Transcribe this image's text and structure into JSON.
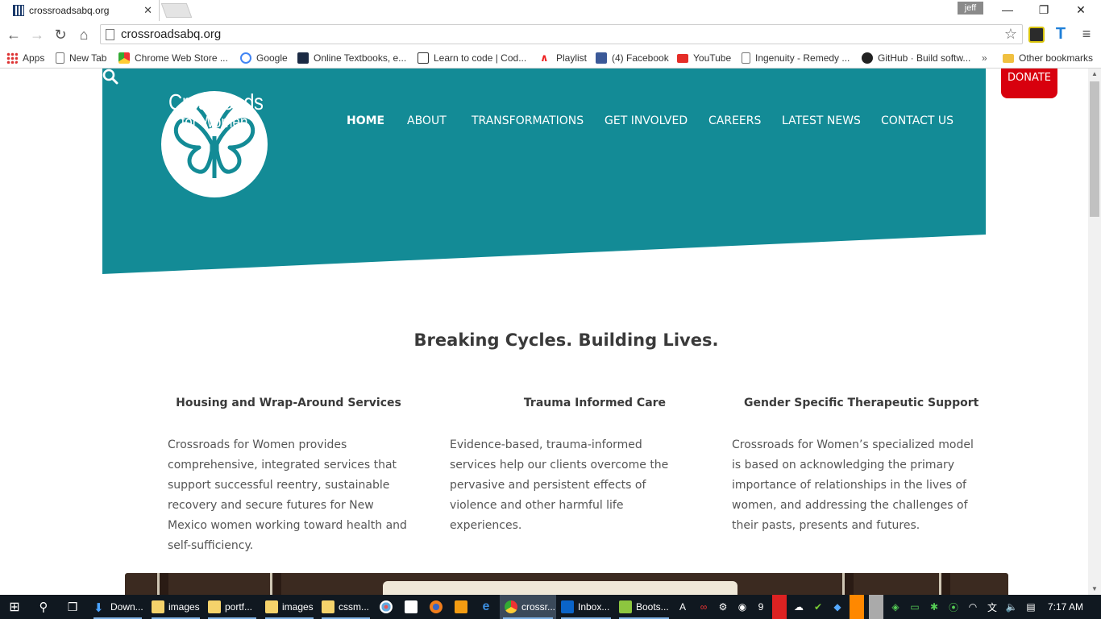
{
  "browser": {
    "tab_title": "crossroadsabq.org",
    "profile_name": "jeff",
    "url": "crossroadsabq.org",
    "bookmarks": [
      {
        "label": "Apps",
        "icon": "apps-grid-icon"
      },
      {
        "label": "New Tab",
        "icon": "page-icon"
      },
      {
        "label": "Chrome Web Store ...",
        "icon": "chrome-webstore-icon"
      },
      {
        "label": "Google",
        "icon": "google-icon"
      },
      {
        "label": "Online Textbooks, e...",
        "icon": "cs-icon"
      },
      {
        "label": "Learn to code | Cod...",
        "icon": "codecademy-icon"
      },
      {
        "label": "Playlist",
        "icon": "playlist-icon"
      },
      {
        "label": "(4) Facebook",
        "icon": "facebook-icon"
      },
      {
        "label": "YouTube",
        "icon": "youtube-icon"
      },
      {
        "label": "Ingenuity - Remedy ...",
        "icon": "page-icon"
      },
      {
        "label": "GitHub · Build softw...",
        "icon": "github-icon"
      }
    ],
    "bookmarks_overflow": "»",
    "other_bookmarks": "Other bookmarks"
  },
  "site": {
    "brand_line1": "Crossroads",
    "brand_line2": "for Women",
    "nav": [
      "HOME",
      "ABOUT",
      "TRANSFORMATIONS",
      "GET INVOLVED",
      "CAREERS",
      "LATEST NEWS",
      "CONTACT US"
    ],
    "active_nav": "HOME",
    "donate_label": "DONATE",
    "tagline": "Breaking Cycles. Building Lives.",
    "features": [
      {
        "title": "Housing and Wrap-Around Services",
        "text": "Crossroads for Women provides comprehensive, integrated services that support successful reentry, sustainable recovery and secure futures for New Mexico women working toward health and self-sufficiency."
      },
      {
        "title": "Trauma Informed Care",
        "text": "Evidence-based, trauma-informed services help our clients overcome the pervasive and persistent effects of violence and other harmful life experiences."
      },
      {
        "title": "Gender Specific Therapeutic Support",
        "text": "Crossroads for Women’s specialized model is based on acknowledging the primary importance of relationships in the lives of women, and addressing the challenges of their pasts, presents and futures."
      }
    ],
    "colors": {
      "teal": "#138b96",
      "donate": "#d8000e",
      "text": "#3a3a3a"
    }
  },
  "taskbar": {
    "items": [
      {
        "label": "Down...",
        "icon": "download-icon"
      },
      {
        "label": "images",
        "icon": "folder-icon"
      },
      {
        "label": "portf...",
        "icon": "folder-icon"
      },
      {
        "label": "images",
        "icon": "folder-icon"
      },
      {
        "label": "cssm...",
        "icon": "folder-icon"
      },
      {
        "label": "crossr...",
        "icon": "chrome-icon"
      },
      {
        "label": "Inbox...",
        "icon": "outlook-icon"
      },
      {
        "label": "Boots...",
        "icon": "notepad-icon"
      }
    ],
    "tray_letter": "A",
    "tray_number": "9",
    "time": "7:17 AM"
  }
}
